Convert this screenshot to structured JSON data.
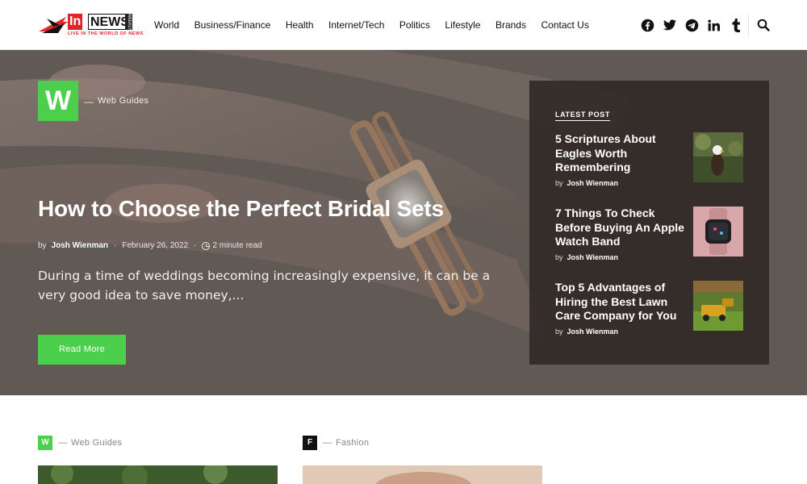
{
  "brand": {
    "logo_in": "In",
    "logo_news": "NEWS",
    "logo_weekly": "WEEKLY",
    "logo_tagline": "LIVE IN THE WORLD OF NEWS",
    "accent_color": "#4ccf4c",
    "logo_red": "#e3232b"
  },
  "nav": {
    "items": [
      "World",
      "Business/Finance",
      "Health",
      "Internet/Tech",
      "Politics",
      "Lifestyle",
      "Brands",
      "Contact Us"
    ]
  },
  "social": {
    "icons": [
      "facebook-icon",
      "twitter-icon",
      "telegram-icon",
      "linkedin-icon",
      "tumblr-icon"
    ]
  },
  "search": {
    "icon": "search-icon"
  },
  "hero": {
    "category_letter": "W",
    "category_dash": "—",
    "category_label": "Web Guides",
    "title": "How to Choose the Perfect Bridal Sets",
    "by": "by",
    "author": "Josh Wienman",
    "dot": "·",
    "date": "February 26, 2022",
    "read_time": "2 minute read",
    "excerpt": "During a time of weddings becoming increasingly expensive, it can be a very good idea to save money,...",
    "read_more": "Read More"
  },
  "latest": {
    "heading": "LATEST POST",
    "posts": [
      {
        "title": "5 Scriptures About Eagles Worth Remembering",
        "by": "by",
        "author": "Josh Wienman"
      },
      {
        "title": "7 Things To Check Before Buying An Apple Watch Band",
        "by": "by",
        "author": "Josh Wienman"
      },
      {
        "title": "Top 5 Advantages of Hiring the Best Lawn Care Company for You",
        "by": "by",
        "author": "Josh Wienman"
      }
    ]
  },
  "cards": [
    {
      "letter": "W",
      "dash": "—",
      "label": "Web Guides",
      "badge_color": "#4ccf4c"
    },
    {
      "letter": "F",
      "dash": "—",
      "label": "Fashion",
      "badge_color": "#111111"
    }
  ]
}
